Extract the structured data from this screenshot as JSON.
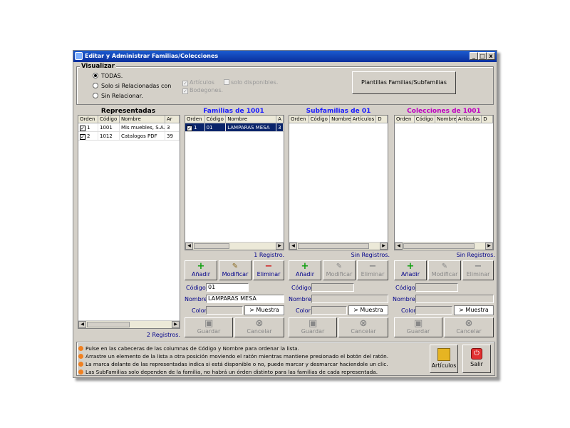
{
  "window": {
    "title": "Editar y Administrar Familias/Colecciones",
    "min": "_",
    "max": "□",
    "close": "x"
  },
  "visualizar": {
    "label": "Visualizar",
    "options": [
      "TODAS.",
      "Solo si Relacionadas con",
      "Sin Relacionar."
    ],
    "selected": 0,
    "articulos": "Artículos",
    "solo_disponibles": "solo disponibles.",
    "bodegones": "Bodegones.",
    "plantillas_button": "Plantillas Familias/Subfamilias"
  },
  "representadas": {
    "title": "Representadas",
    "columns": [
      "Orden",
      "Código",
      "Nombre",
      "Ar"
    ],
    "rows": [
      {
        "orden": "1",
        "codigo": "1001",
        "nombre": "Mis muebles, S.A.",
        "ar": "3",
        "checked": true
      },
      {
        "orden": "2",
        "codigo": "1012",
        "nombre": "Catalogos PDF",
        "ar": "39",
        "checked": true
      }
    ],
    "registros": "2 Registros."
  },
  "familias": {
    "title": "Familias de 1001",
    "columns": [
      "Orden",
      "Código",
      "Nombre",
      "A"
    ],
    "rows": [
      {
        "orden": "1",
        "codigo": "01",
        "nombre": "LAMPARAS MESA",
        "a": "3",
        "checked": true
      }
    ],
    "registros": "1 Registro.",
    "anadir": "Añadir",
    "modificar": "Modificar",
    "eliminar": "Eliminar",
    "codigo_label": "Código",
    "codigo_value": "01",
    "nombre_label": "Nombre",
    "nombre_value": "LAMPARAS MESA",
    "color_label": "Color",
    "muestra": "> Muestra",
    "guardar": "Guardar",
    "cancelar": "Cancelar"
  },
  "subfamilias": {
    "title": "Subfamilias de 01",
    "columns": [
      "Orden",
      "Código",
      "Nombre",
      "Artículos",
      "D"
    ],
    "registros": "Sin Registros.",
    "anadir": "Añadir",
    "modificar": "Modificar",
    "eliminar": "Eliminar",
    "codigo_label": "Código",
    "nombre_label": "Nombre",
    "color_label": "Color",
    "muestra": "> Muestra",
    "guardar": "Guardar",
    "cancelar": "Cancelar"
  },
  "colecciones": {
    "title": "Colecciones de 1001",
    "columns": [
      "Orden",
      "Código",
      "Nombre",
      "Artículos",
      "D"
    ],
    "registros": "Sin Registros.",
    "anadir": "Añadir",
    "modificar": "Modificar",
    "eliminar": "Eliminar",
    "codigo_label": "Código",
    "nombre_label": "Nombre",
    "color_label": "Color",
    "muestra": "> Muestra",
    "guardar": "Guardar",
    "cancelar": "Cancelar"
  },
  "notes": [
    "Pulse en las cabeceras de las columnas de Código y Nombre para ordenar la lista.",
    "Arrastre un elemento de la lista a otra posición moviendo el ratón mientras mantiene presionado el botón del ratón.",
    "La marca delante de las representadas indica si está disponible o no, puede marcar y desmarcar haciendole un clic.",
    "Las SubFamilias solo dependen de la familia, no habrá un órden distinto para las familias de cada representada."
  ],
  "buttons": {
    "articulos": "Artículos",
    "salir": "Salir"
  },
  "colors": {
    "familias_title": "#1a1aff",
    "subfamilias_title": "#1a1aff",
    "colecciones_title": "#c000c0",
    "title_bar": "#0a2f9c",
    "selection": "#0a246a"
  }
}
